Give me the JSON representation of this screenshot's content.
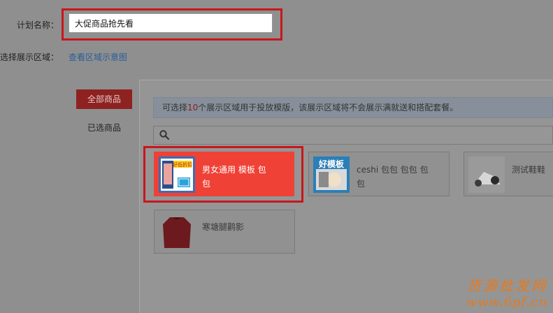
{
  "form": {
    "plan_name_label": "计划名称：",
    "plan_name_value": "大促商品抢先看",
    "region_label": "选择展示区域：",
    "region_link": "查看区域示意图"
  },
  "tabs": {
    "all_products": "全部商品",
    "selected_products": "已选商品"
  },
  "notice": {
    "prefix": "可选择",
    "count": "10",
    "suffix": "个展示区域用于投放模版，该展示区域将不会展示满就送和搭配套餐。"
  },
  "search": {
    "placeholder": ""
  },
  "templates": [
    {
      "name": "男女通用 模板 包包",
      "line1": "男女通用 模板 包",
      "line2": "包",
      "selected": true,
      "thumb_text": "好低折扣"
    },
    {
      "name": "ceshi 包包 包包 包包",
      "line1": "ceshi 包包 包包 包",
      "line2": "包",
      "selected": false,
      "thumb_text": "好模板"
    },
    {
      "name": "测试鞋鞋",
      "line1": "测试鞋鞋",
      "line2": "",
      "selected": false
    },
    {
      "name": "寒塘腿鹳影",
      "line1": "寒塘腿鹳影",
      "line2": "",
      "selected": false
    }
  ],
  "watermark": {
    "line1": "货源批发网",
    "line2": "www.6pf.cn"
  },
  "colors": {
    "accent_red": "#ef4136",
    "highlight_red": "#c8161d",
    "link_blue": "#2a5f9a",
    "overlay_gray": "#8f8f8f"
  }
}
